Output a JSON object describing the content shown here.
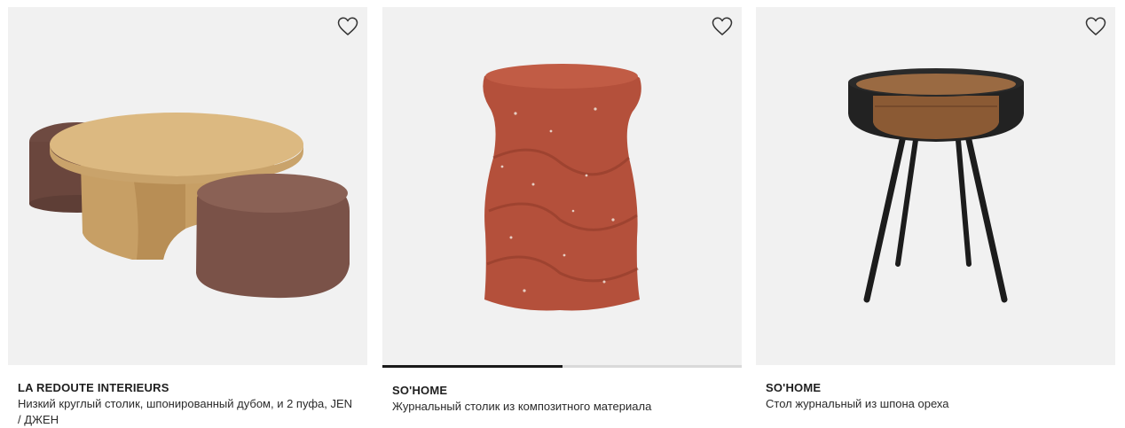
{
  "products": [
    {
      "brand": "LA REDOUTE INTERIEURS",
      "title": "Низкий круглый столик, шпонированный дубом, и 2 пуфа, JEN / ДЖЕН",
      "image_icon": "coffee-table-with-poufs",
      "favorite_icon": "heart-outline-icon",
      "carousel_progress": null
    },
    {
      "brand": "SO'HOME",
      "title": "Журнальный столик из композитного материала",
      "image_icon": "terrazzo-side-table",
      "favorite_icon": "heart-outline-icon",
      "carousel_progress": 0.5
    },
    {
      "brand": "SO'HOME",
      "title": "Стол журнальный из шпона ореха",
      "image_icon": "round-walnut-side-table",
      "favorite_icon": "heart-outline-icon",
      "carousel_progress": null
    }
  ],
  "colors": {
    "image_background": "#f1f1f1",
    "progress_fill": "#1a1a1a",
    "progress_track": "#d9d9d9",
    "brand_text": "#1e1e1e"
  }
}
